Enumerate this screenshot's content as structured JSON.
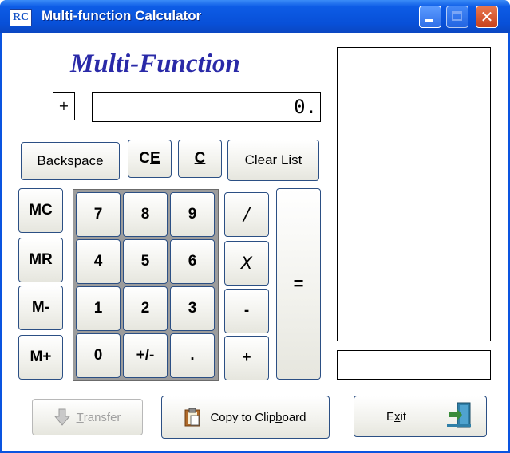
{
  "window": {
    "title": "Multi-function Calculator",
    "app_icon_text": "RC",
    "close_glyph": "✕"
  },
  "heading": "Multi-Function",
  "display": {
    "sign": "+",
    "value": "0."
  },
  "top_buttons": {
    "backspace": "Backspace",
    "ce_c": "C",
    "ce_e": "E",
    "c": "C",
    "clear_list": "Clear List"
  },
  "memory": [
    "MC",
    "MR",
    "M-",
    "M+"
  ],
  "keypad": [
    [
      "7",
      "8",
      "9"
    ],
    [
      "4",
      "5",
      "6"
    ],
    [
      "1",
      "2",
      "3"
    ],
    [
      "0",
      "+/-",
      "."
    ]
  ],
  "operators": [
    "/",
    "X",
    "-",
    "+"
  ],
  "equals": "=",
  "bottom": {
    "transfer_pre": "",
    "transfer_u": "T",
    "transfer_post": "ransfer",
    "copy_pre": "Copy to Clip",
    "copy_u": "b",
    "copy_post": "oard",
    "exit_pre": "E",
    "exit_u": "x",
    "exit_post": "it"
  },
  "colors": {
    "titlebar": "#0a54e0",
    "heading": "#2a2aa8",
    "button_border": "#2b4f84",
    "keypad_bg": "#9c9c9c"
  },
  "icons": {
    "transfer": "down-arrow-icon",
    "copy": "clipboard-icon",
    "exit": "exit-door-icon"
  }
}
